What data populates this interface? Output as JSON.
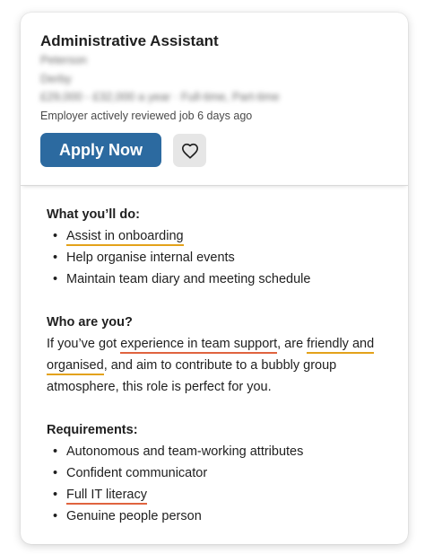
{
  "job": {
    "title": "Administrative Assistant",
    "company_blurred": "Peterson",
    "location_blurred": "Derby",
    "salary_blurred": "£29,000 - £32,000 a year · Full-time, Part-time",
    "reviewed": "Employer actively reviewed job 6 days ago",
    "apply_label": "Apply Now"
  },
  "icons": {
    "save": "heart-icon"
  },
  "sections": {
    "what_title": "What you’ll do:",
    "what_items": [
      "Assist in onboarding",
      "Help organise internal events",
      "Maintain team diary and meeting schedule"
    ],
    "who_title": "Who are you?",
    "who_text": {
      "t1": "If you’ve got ",
      "hl1": "experience in team support",
      "t2": ", are ",
      "hl2a": "friendly and",
      "hl2b": "organised",
      "t3": ", and aim to contribute to a bubbly group atmosphere, this role is perfect for you."
    },
    "req_title": "Requirements:",
    "req_items": [
      "Autonomous and team-working attributes",
      "Confident communicator",
      "Full IT literacy",
      "Genuine people person"
    ]
  },
  "colors": {
    "apply_button": "#2c6aa0",
    "highlight_yellow": "#e3a21a",
    "highlight_red": "#e0633f"
  }
}
